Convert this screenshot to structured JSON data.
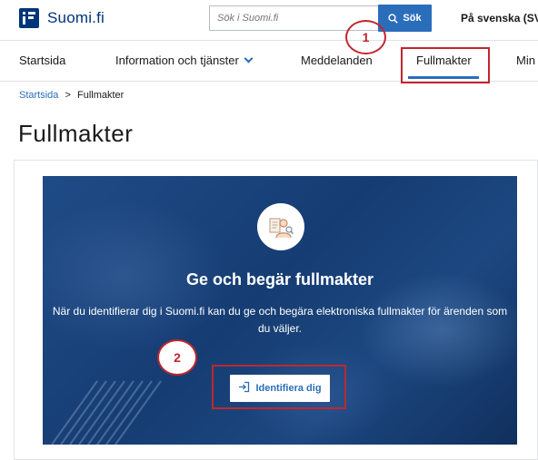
{
  "header": {
    "logo_text": "Suomi.fi",
    "search": {
      "placeholder": "Sök i Suomi.fi",
      "button_label": "Sök"
    },
    "language": "På svenska (SV)"
  },
  "nav": {
    "items": [
      {
        "label": "Startsida"
      },
      {
        "label": "Information och tjänster"
      },
      {
        "label": "Meddelanden"
      },
      {
        "label": "Fullmakter"
      },
      {
        "label": "Min"
      }
    ],
    "active": "Fullmakter"
  },
  "breadcrumb": {
    "home": "Startsida",
    "separator": ">",
    "current": "Fullmakter"
  },
  "page_title": "Fullmakter",
  "hero": {
    "title": "Ge och begär fullmakter",
    "text": "När du identifierar dig i Suomi.fi kan du ge och begära elektroniska fullmakter för ärenden som du väljer.",
    "button_label": "Identifiera dig",
    "icon": "person-document-icon"
  },
  "annotations": {
    "marker_1": "1",
    "marker_2": "2"
  },
  "colors": {
    "brand": "#003479",
    "accent": "#2a6ebb",
    "highlight": "#c0272d",
    "hero": "#1a4580"
  },
  "icons": [
    "suomi-logo-icon",
    "search-icon",
    "chevron-down-icon",
    "person-document-icon",
    "sign-in-icon"
  ]
}
